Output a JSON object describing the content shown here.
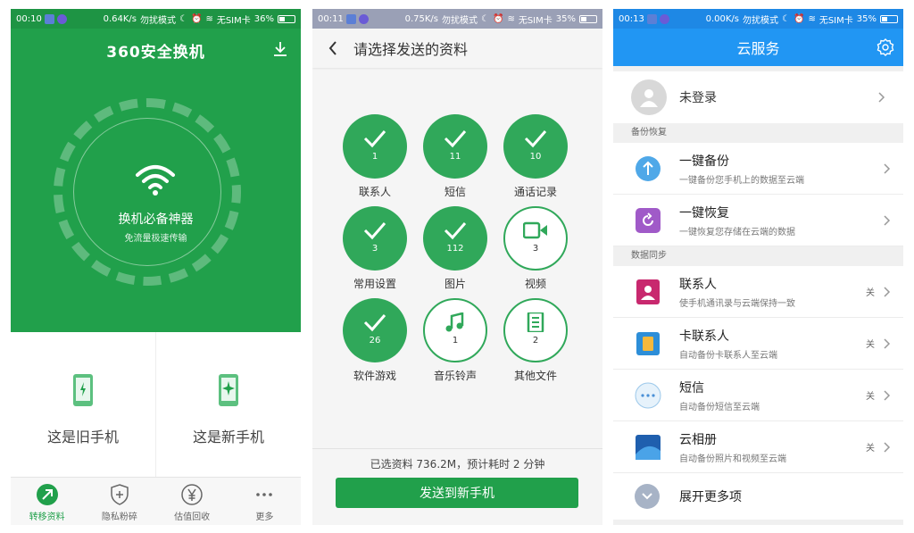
{
  "screen1": {
    "status": {
      "time": "00:10",
      "speed": "0.64K/s",
      "mode": "勿扰模式",
      "sim": "无SIM卡",
      "battery": "36%"
    },
    "logo": "360安全换机",
    "hero_title": "换机必备神器",
    "hero_subtitle": "免流量极速传输",
    "old_phone_label": "这是旧手机",
    "new_phone_label": "这是新手机",
    "tabs": [
      {
        "label": "转移资料",
        "icon": "transfer-icon"
      },
      {
        "label": "隐私粉碎",
        "icon": "shield-icon"
      },
      {
        "label": "估值回收",
        "icon": "yen-icon"
      },
      {
        "label": "更多",
        "icon": "more-icon"
      }
    ],
    "accent": "#21a04b"
  },
  "screen2": {
    "status": {
      "time": "00:11",
      "speed": "0.75K/s",
      "mode": "勿扰模式",
      "sim": "无SIM卡",
      "battery": "35%"
    },
    "title": "请选择发送的资料",
    "items": [
      {
        "label": "联系人",
        "count": "1",
        "selected": true
      },
      {
        "label": "短信",
        "count": "11",
        "selected": true
      },
      {
        "label": "通话记录",
        "count": "10",
        "selected": true
      },
      {
        "label": "常用设置",
        "count": "3",
        "selected": true
      },
      {
        "label": "图片",
        "count": "112",
        "selected": true
      },
      {
        "label": "视频",
        "count": "3",
        "selected": false,
        "icon": "video-icon"
      },
      {
        "label": "软件游戏",
        "count": "26",
        "selected": true
      },
      {
        "label": "音乐铃声",
        "count": "1",
        "selected": false,
        "icon": "music-icon"
      },
      {
        "label": "其他文件",
        "count": "2",
        "selected": false,
        "icon": "document-icon"
      }
    ],
    "summary": "已选资料 736.2M，预计耗时 2 分钟",
    "send_button": "发送到新手机"
  },
  "screen3": {
    "status": {
      "time": "00:13",
      "speed": "0.00K/s",
      "mode": "勿扰模式",
      "sim": "无SIM卡",
      "battery": "35%"
    },
    "title": "云服务",
    "login_label": "未登录",
    "section_backup": "备份恢复",
    "section_sync": "数据同步",
    "backup_rows": [
      {
        "title": "一键备份",
        "subtitle": "一键备份您手机上的数据至云端"
      },
      {
        "title": "一键恢复",
        "subtitle": "一键恢复您存储在云端的数据"
      }
    ],
    "sync_rows": [
      {
        "title": "联系人",
        "subtitle": "使手机通讯录与云端保持一致",
        "state": "关"
      },
      {
        "title": "卡联系人",
        "subtitle": "自动备份卡联系人至云端",
        "state": "关"
      },
      {
        "title": "短信",
        "subtitle": "自动备份短信至云端",
        "state": "关"
      },
      {
        "title": "云相册",
        "subtitle": "自动备份照片和视频至云端",
        "state": "关"
      }
    ],
    "expand_label": "展开更多项",
    "accent": "#2196f3"
  }
}
